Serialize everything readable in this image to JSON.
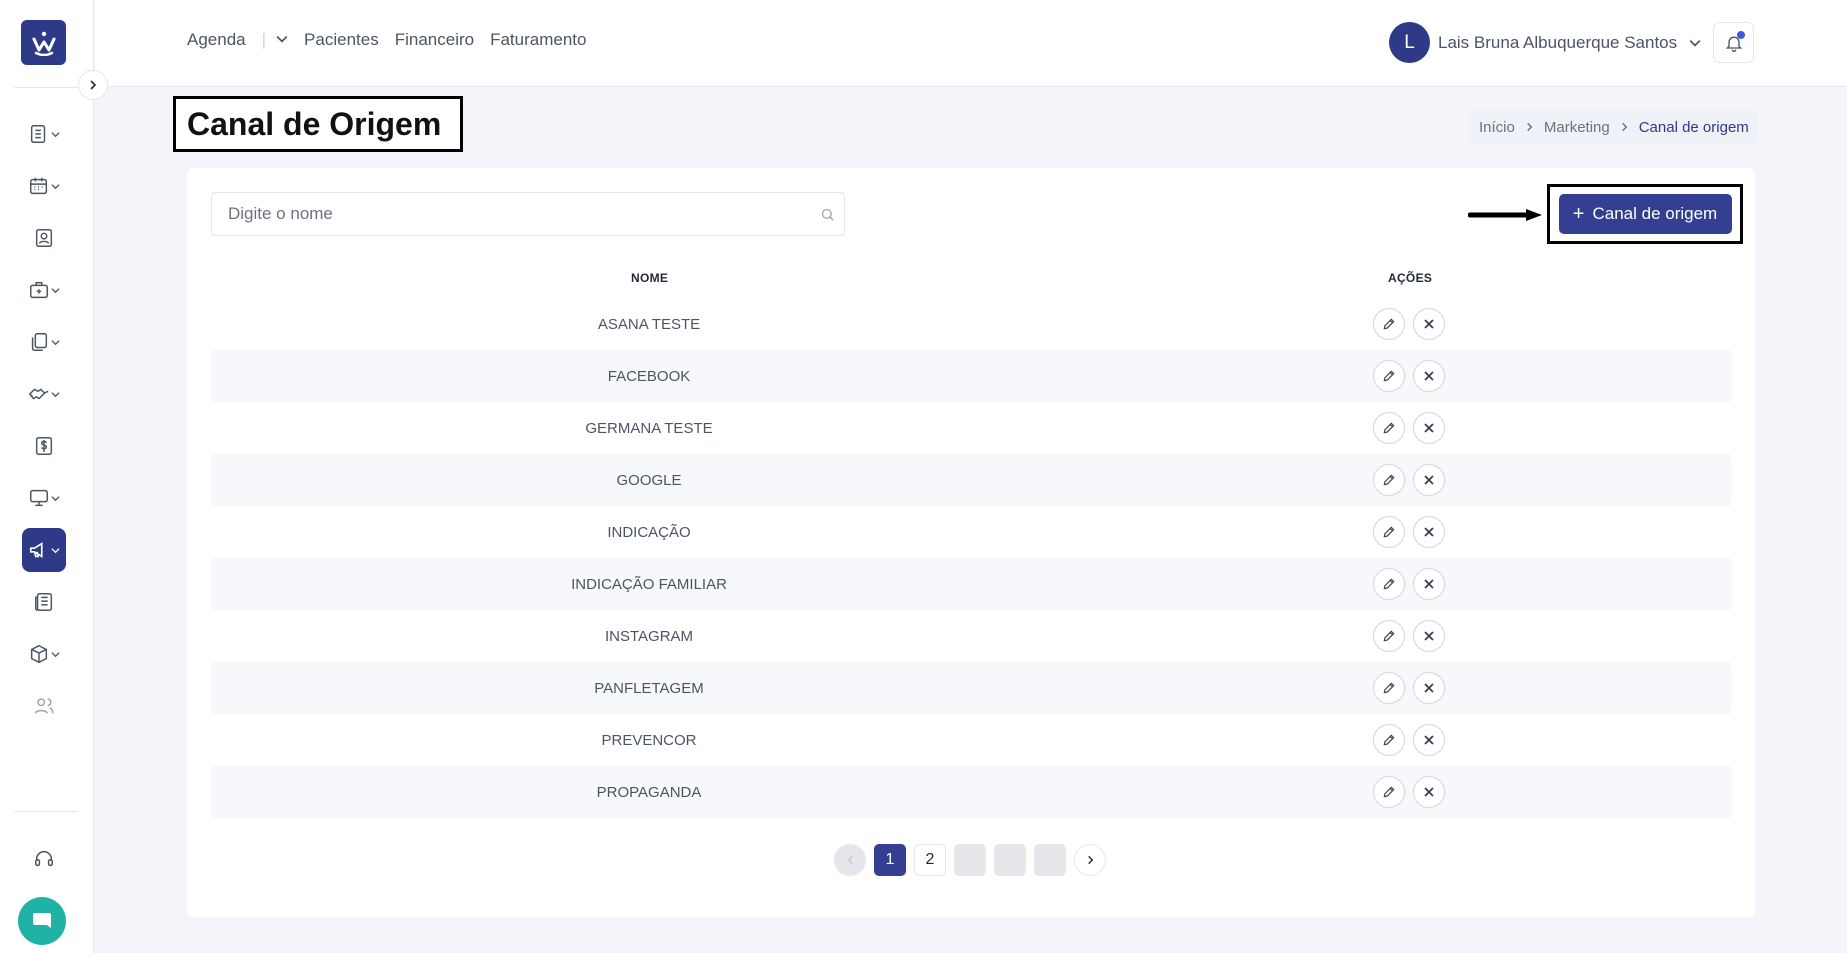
{
  "topnav": {
    "agenda": "Agenda",
    "separator": "|",
    "pacientes": "Pacientes",
    "financeiro": "Financeiro",
    "faturamento": "Faturamento"
  },
  "user": {
    "initial": "L",
    "name": "Lais Bruna Albuquerque Santos"
  },
  "page": {
    "title": "Canal de Origem"
  },
  "breadcrumb": {
    "items": [
      "Início",
      "Marketing",
      "Canal de origem"
    ]
  },
  "search": {
    "placeholder": "Digite o nome"
  },
  "add_button": {
    "icon": "+",
    "label": "Canal de origem"
  },
  "table": {
    "headers": [
      "NOME",
      "AÇÕES"
    ],
    "rows": [
      "ASANA TESTE",
      "FACEBOOK",
      "GERMANA TESTE",
      "GOOGLE",
      "INDICAÇÃO",
      "INDICAÇÃO FAMILIAR",
      "INSTAGRAM",
      "PANFLETAGEM",
      "PREVENCOR",
      "PROPAGANDA"
    ]
  },
  "pagination": {
    "pages": [
      "1",
      "2",
      "",
      "",
      ""
    ],
    "current": "1"
  },
  "sidebar": {
    "items": [
      "list-icon",
      "calendar-icon",
      "patient-badge-icon",
      "medical-bag-icon",
      "documents-icon",
      "handshake-icon",
      "dollar-icon",
      "monitor-icon",
      "megaphone-icon",
      "newspaper-icon",
      "box-icon",
      "users-icon"
    ],
    "active": "megaphone-icon"
  },
  "colors": {
    "primary": "#343f92",
    "logo": "#2e3a87",
    "chat": "#20b2a4",
    "background": "#f3f5fa"
  }
}
